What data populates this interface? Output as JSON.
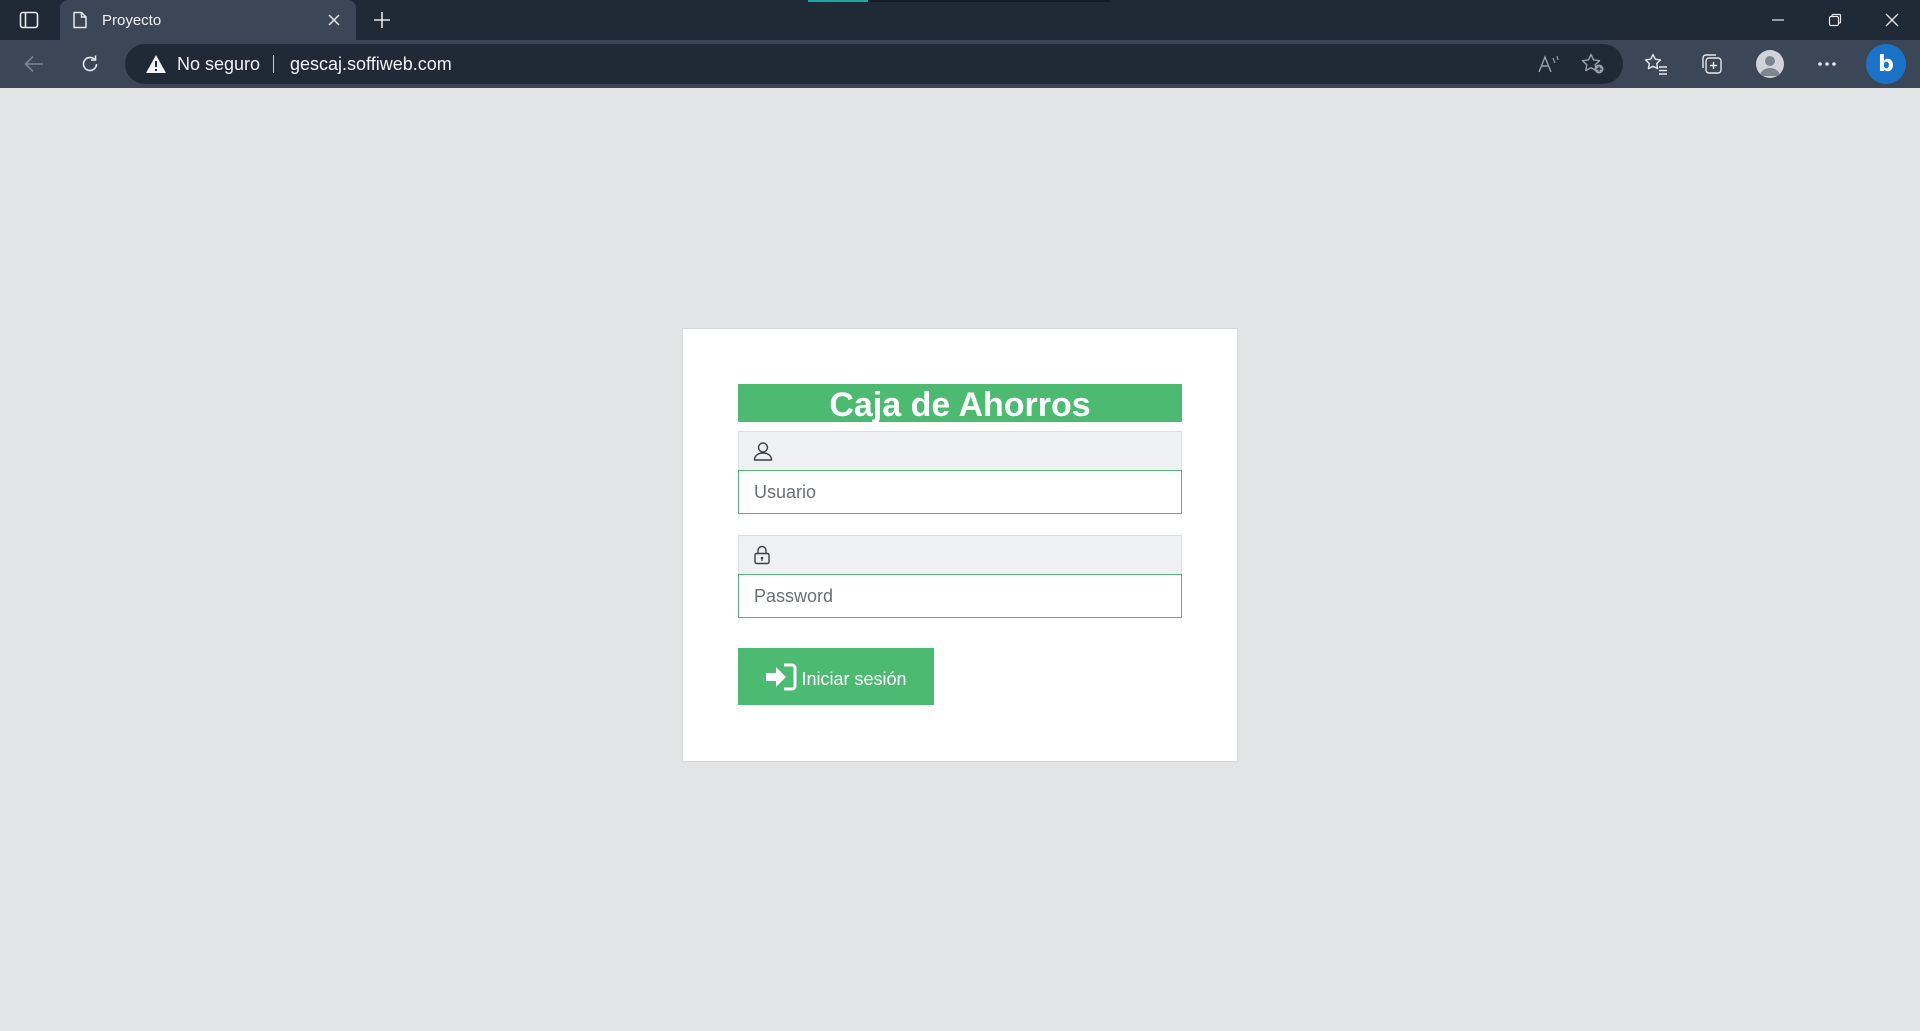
{
  "browser": {
    "tab": {
      "title": "Proyecto"
    },
    "address": {
      "security_label": "No seguro",
      "url": "gescaj.soffiweb.com"
    },
    "colors": {
      "titlebar": "#202a36",
      "toolbar": "#3b4656",
      "accent": "#19a6a6"
    }
  },
  "login": {
    "title": "Caja de Ahorros",
    "username": {
      "placeholder": "Usuario",
      "value": "",
      "icon": "user-icon"
    },
    "password": {
      "placeholder": "Password",
      "value": "",
      "icon": "lock-icon"
    },
    "submit": {
      "label": "Iniciar sesión",
      "icon": "sign-in-icon"
    },
    "colors": {
      "accent": "#4cbb71",
      "background": "#e3e4e6",
      "card": "#ffffff"
    }
  }
}
